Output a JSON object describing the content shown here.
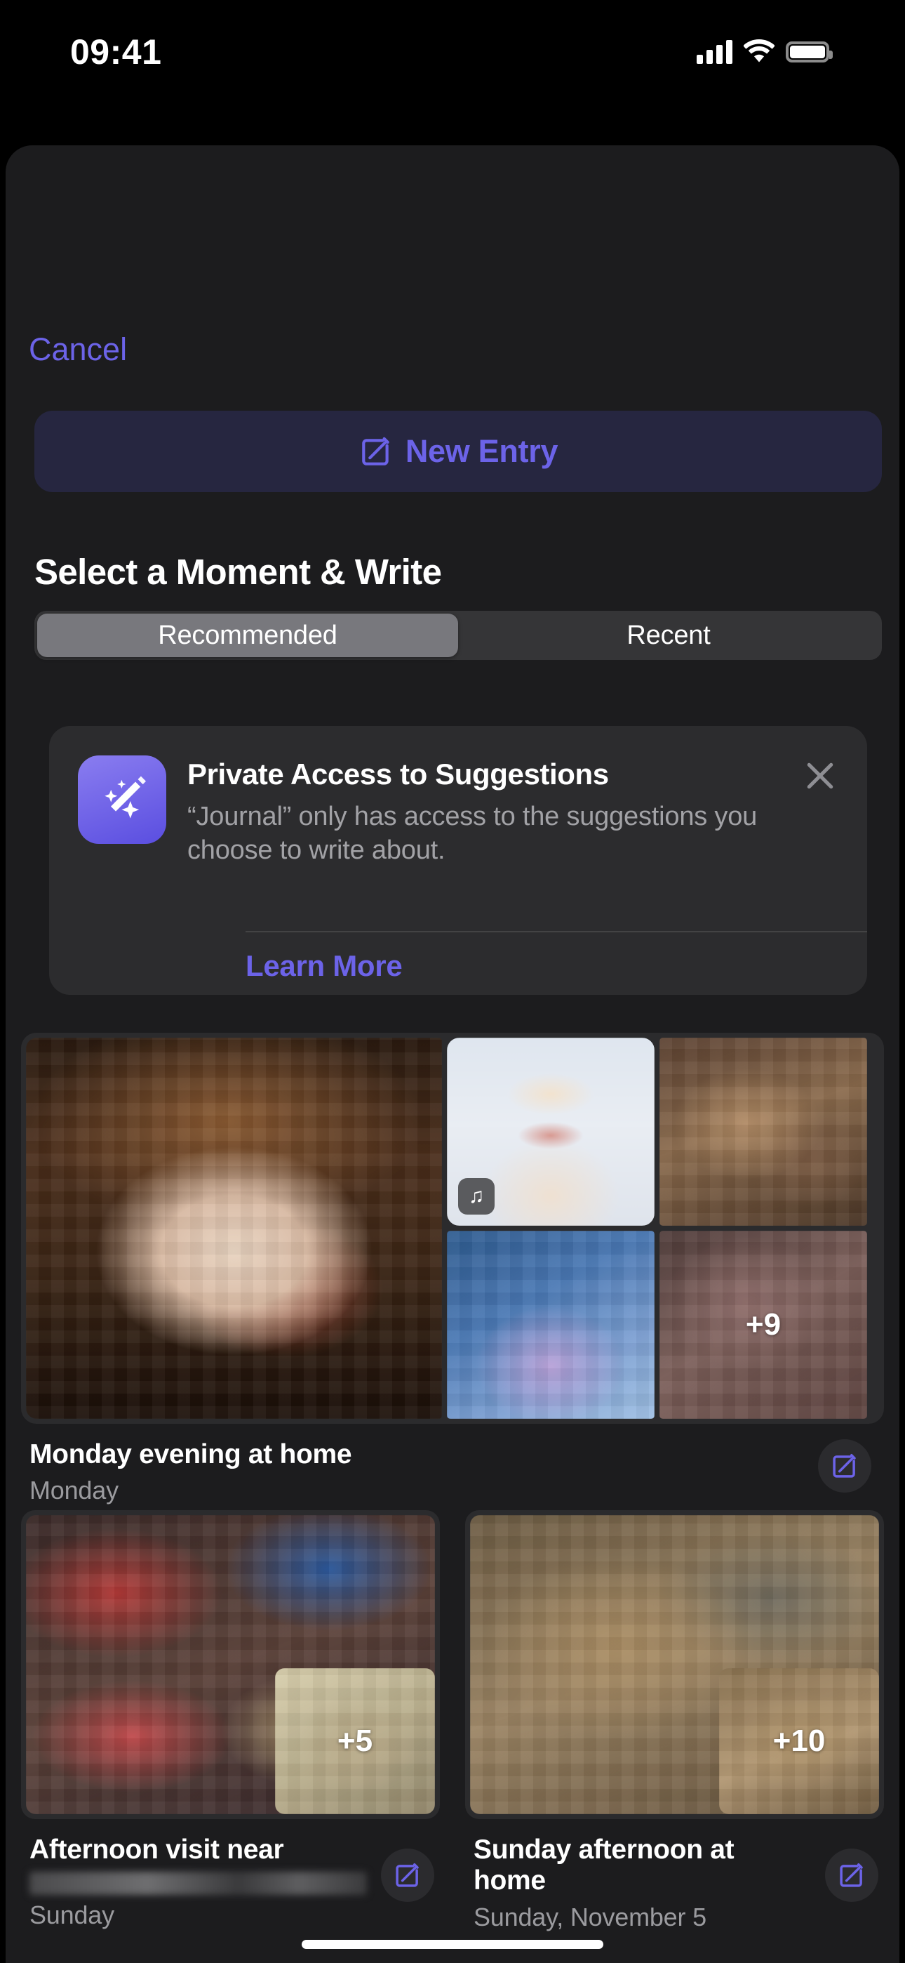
{
  "status_bar": {
    "time": "09:41",
    "signal_icon": "cellular-bars-icon",
    "wifi_icon": "wifi-icon",
    "battery_icon": "battery-icon"
  },
  "sheet": {
    "cancel_label": "Cancel",
    "new_entry": {
      "label": "New Entry",
      "icon": "compose-icon",
      "accent_color": "#6c63e8",
      "background_color": "#262640"
    },
    "title": "Select a Moment & Write",
    "segmented_control": {
      "options": [
        "Recommended",
        "Recent"
      ],
      "selected": "Recommended",
      "selected_index": 0
    },
    "private_access_card": {
      "icon": "magic-wand-sparkles-icon",
      "title": "Private Access to Suggestions",
      "description": "“Journal” only has access to the suggestions you choose to write about.",
      "learn_more_label": "Learn More",
      "close_icon": "close-icon"
    },
    "suggestions": [
      {
        "title": "Monday evening at home",
        "subtitle": "Monday",
        "subtitle_blurred": false,
        "compose_icon": "compose-icon",
        "layout": "large",
        "tiles": [
          {
            "name": "photo-main",
            "style": "warm-dark",
            "badge": null,
            "overlay": null
          },
          {
            "name": "photo-portrait",
            "style": "portrait",
            "badge": "music-note-icon",
            "overlay": null
          },
          {
            "name": "photo-top-right",
            "style": "warm-brown",
            "badge": null,
            "overlay": null
          },
          {
            "name": "photo-sky",
            "style": "sky",
            "badge": null,
            "overlay": null
          },
          {
            "name": "photo-more",
            "style": "mauve",
            "badge": null,
            "overlay": "+9"
          }
        ]
      },
      {
        "title": "Afternoon visit near",
        "subtitle": "Sunday",
        "subtitle_blurred": true,
        "compose_icon": "compose-icon",
        "layout": "small",
        "tiles": [
          {
            "name": "photo-main",
            "style": "redblue",
            "badge": null,
            "overlay": null
          },
          {
            "name": "photo-more",
            "style": "sand",
            "badge": null,
            "overlay": "+5"
          }
        ]
      },
      {
        "title": "Sunday afternoon at home",
        "subtitle": "Sunday, November 5",
        "subtitle_blurred": false,
        "compose_icon": "compose-icon",
        "layout": "small",
        "tiles": [
          {
            "name": "photo-main",
            "style": "tan",
            "badge": null,
            "overlay": null
          },
          {
            "name": "photo-more",
            "style": "tan3",
            "badge": null,
            "overlay": "+10"
          }
        ]
      }
    ]
  },
  "home_indicator": "home-indicator"
}
